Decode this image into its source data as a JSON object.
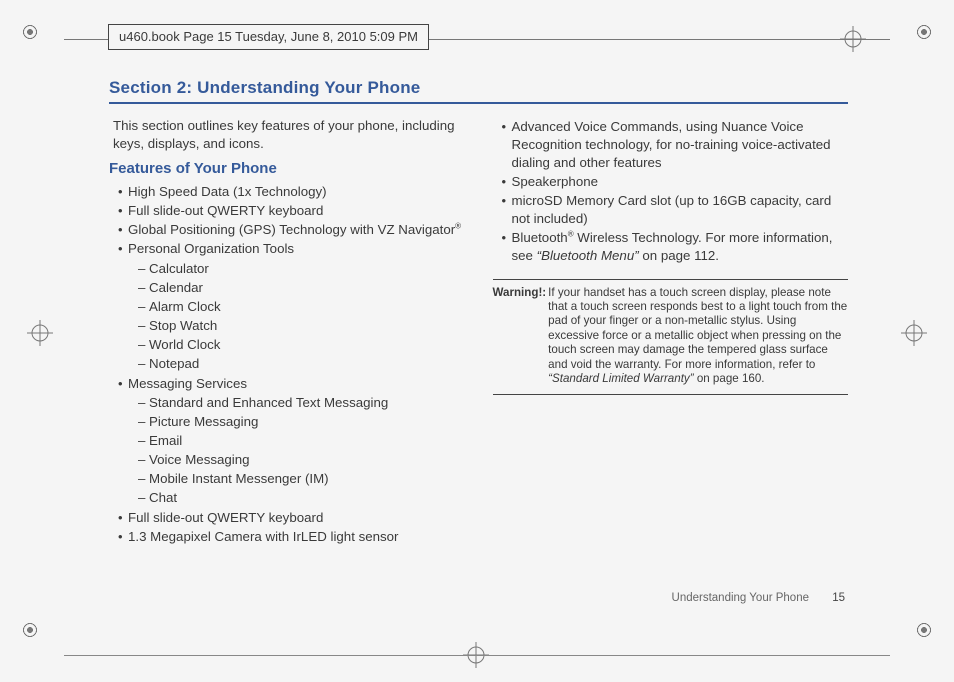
{
  "header": {
    "stamp": "u460.book  Page 15  Tuesday, June 8, 2010  5:09 PM"
  },
  "section_title": "Section 2: Understanding Your Phone",
  "intro": "This section outlines key features of your phone, including keys, displays, and icons.",
  "features_heading": "Features of Your Phone",
  "left_features": {
    "b1": "High Speed Data (1x Technology)",
    "b2": "Full slide-out QWERTY keyboard",
    "b3_pre": "Global Positioning (GPS) Technology with VZ Navigator",
    "b4": "Personal Organization Tools",
    "org": {
      "d1": "Calculator",
      "d2": "Calendar",
      "d3": "Alarm Clock",
      "d4": "Stop Watch",
      "d5": "World Clock",
      "d6": "Notepad"
    },
    "b5": "Messaging Services",
    "msg": {
      "d1": "Standard and Enhanced Text Messaging",
      "d2": "Picture Messaging",
      "d3": "Email",
      "d4": "Voice Messaging",
      "d5": "Mobile Instant Messenger (IM)",
      "d6": "Chat"
    },
    "b6": "Full slide-out QWERTY keyboard",
    "b7": "1.3 Megapixel Camera with IrLED light sensor"
  },
  "right_features": {
    "b1": "Advanced Voice Commands, using Nuance Voice Recognition technology, for no-training voice-activated dialing and other features",
    "b2": "Speakerphone",
    "b3": "microSD Memory Card slot (up to 16GB capacity, card not included)",
    "b4_pre": "Bluetooth",
    "b4_post": " Wireless Technology. For more information, see ",
    "b4_link": "“Bluetooth Menu”",
    "b4_tail": " on page 112."
  },
  "warning": {
    "label": "Warning!:",
    "text_a": "If your handset has a touch screen display, please note that a touch screen responds best to a light touch from the pad of your finger or a non-metallic stylus. Using excessive force or a metallic object when pressing on the touch screen may damage the tempered glass surface and void the warranty. For more information, refer to ",
    "text_link": "“Standard Limited Warranty”",
    "text_b": "  on page 160."
  },
  "footer": {
    "label": "Understanding Your Phone",
    "page": "15"
  }
}
